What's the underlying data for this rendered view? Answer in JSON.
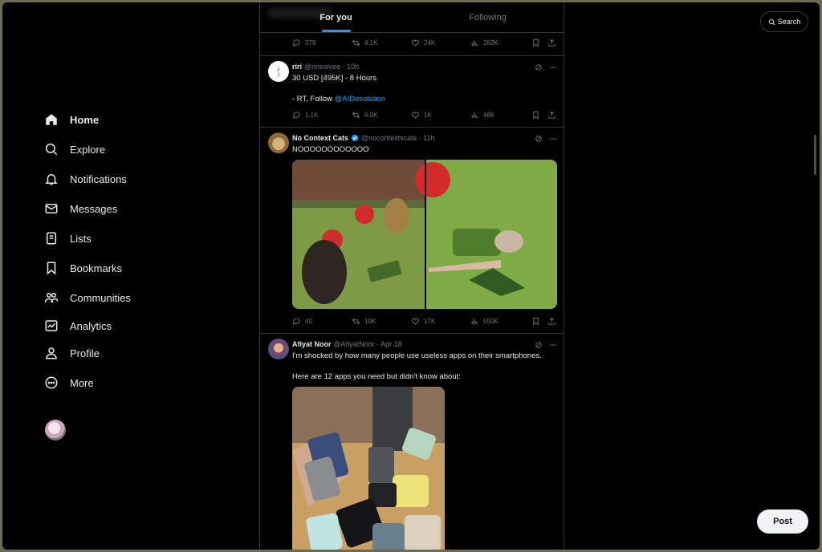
{
  "nav": [
    {
      "label": "Home",
      "icon": "home-icon",
      "active": true
    },
    {
      "label": "Explore",
      "icon": "search-icon"
    },
    {
      "label": "Notifications",
      "icon": "bell-icon"
    },
    {
      "label": "Messages",
      "icon": "mail-icon"
    },
    {
      "label": "Lists",
      "icon": "list-icon"
    },
    {
      "label": "Bookmarks",
      "icon": "bookmark-icon"
    },
    {
      "label": "Communities",
      "icon": "people-icon"
    },
    {
      "label": "Analytics",
      "icon": "chart-icon"
    },
    {
      "label": "Profile",
      "icon": "person-icon"
    },
    {
      "label": "More",
      "icon": "more-icon"
    }
  ],
  "tabs": {
    "for_you": "For you",
    "following": "Following"
  },
  "top_stats": {
    "replies": "379",
    "reposts": "8.1K",
    "likes": "24K",
    "views": "282K"
  },
  "tweets": [
    {
      "name": "riri",
      "handle": "@rinesivee · 10h",
      "line1": "30 USD [495K] - 8 Hours",
      "line2": "- RT, Follow ",
      "mention": "@AIDesolation",
      "stats": {
        "replies": "1.1K",
        "reposts": "6.9K",
        "likes": "1K",
        "views": "46K"
      }
    },
    {
      "name": "No Context Cats",
      "handle": "@nocontextscats · 11h",
      "text": "NOOOOOOOOOOOO",
      "stats": {
        "replies": "40",
        "reposts": "10K",
        "likes": "17K",
        "views": "550K"
      }
    },
    {
      "name": "Afiyat Noor",
      "handle": "@AfiyatNoor · Apr 18",
      "line1": "I'm shocked by how many people use useless apps on their smartphones.",
      "line2": "Here are 12 apps you need but didn't know about:"
    }
  ],
  "search": {
    "label": "Search"
  },
  "post_button": "Post",
  "colors": {
    "accent": "#1d9bf0",
    "border": "#2f3336",
    "muted": "#71767b",
    "background": "#000000"
  }
}
